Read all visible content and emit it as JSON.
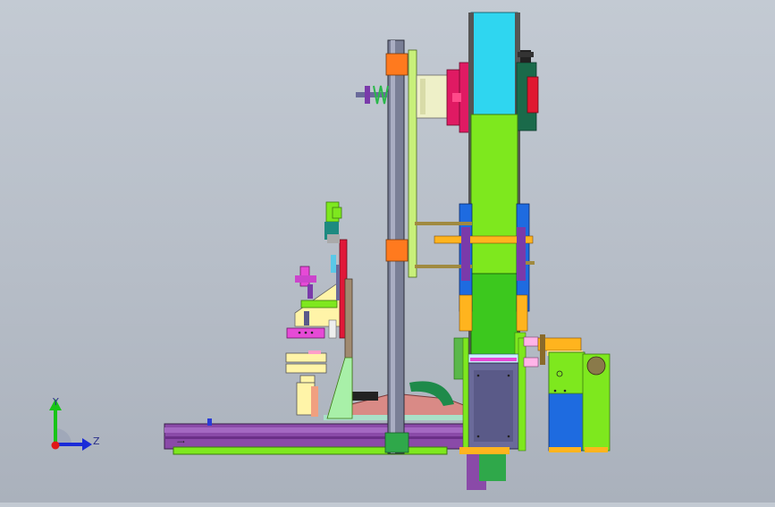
{
  "viewport": {
    "background_top": "#c3cad3",
    "background_bottom": "#aab1bc"
  },
  "triad": {
    "y_label": "Y",
    "z_label": "Z",
    "y_color": "#18c418",
    "z_color": "#1a2bd8",
    "x_color": "#e01818"
  },
  "parts": {
    "flywheel_color": "#2fd6f0",
    "frame_color": "#7ee81e",
    "guide_rail_color": "#8a4aa8",
    "column_color": "#7a7f96",
    "hub_color": "#e01a63",
    "motor_color": "#1e6be0"
  }
}
